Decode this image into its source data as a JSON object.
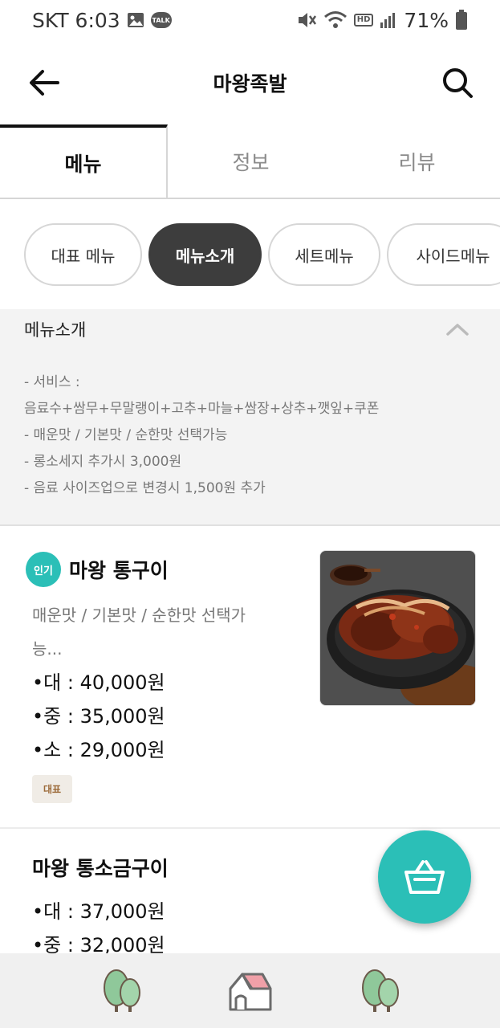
{
  "status_bar": {
    "carrier_time": "SKT 6:03",
    "talk_label": "TALK",
    "hd_label": "HD",
    "battery": "71%"
  },
  "app_bar": {
    "title": "마왕족발",
    "back_icon": "arrow-left-icon",
    "search_icon": "search-icon"
  },
  "tabs": [
    {
      "label": "메뉴",
      "active": true
    },
    {
      "label": "정보",
      "active": false
    },
    {
      "label": "리뷰",
      "active": false
    }
  ],
  "chips": [
    {
      "label": "대표 메뉴",
      "active": false
    },
    {
      "label": "메뉴소개",
      "active": true
    },
    {
      "label": "세트메뉴",
      "active": false
    },
    {
      "label": "사이드메뉴",
      "active": false
    }
  ],
  "intro": {
    "heading": "메뉴소개",
    "lines": [
      "- 서비스 :",
      "음료수+쌈무+무말랭이+고추+마늘+쌈장+상추+깻잎+쿠폰",
      "- 매운맛 / 기본맛 / 순한맛 선택가능",
      "- 롱소세지 추가시 3,000원",
      "- 음료 사이즈업으로 변경시 1,500원 추가"
    ]
  },
  "items": [
    {
      "badge": "인기",
      "name": "마왕 통구이",
      "description": "매운맛 / 기본맛 / 순한맛 선택가능...",
      "prices": [
        "•대 : 40,000원",
        "•중 : 35,000원",
        "•소 : 29,000원"
      ],
      "tag": "대표"
    },
    {
      "name": "마왕 통소금구이",
      "prices": [
        "•대 : 37,000원",
        "•중 : 32,000원"
      ]
    }
  ],
  "colors": {
    "accent": "#2bbfb7",
    "chip_active": "#3d3d3d",
    "muted_text": "#777777",
    "section_bg": "#f3f3f3",
    "nav_bg": "#f0f0f0"
  },
  "bottom_nav": [
    "tree-icon",
    "home-icon",
    "tree-icon"
  ]
}
